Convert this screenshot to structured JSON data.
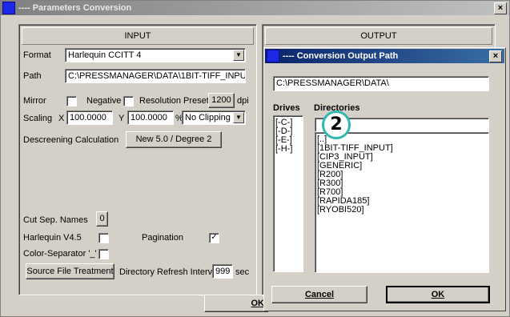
{
  "main_window": {
    "title": "----   Parameters Conversion",
    "close_glyph": "×"
  },
  "input_panel": {
    "header": "INPUT",
    "format_label": "Format",
    "format_value": "Harlequin CCITT 4",
    "path_label": "Path",
    "path_value": "C:\\PRESSMANAGER\\DATA\\1BIT-TIFF_INPU",
    "mirror_label": "Mirror",
    "negative_label": "Negative",
    "resolution_preset_label": "Resolution Preset",
    "resolution_value": "1200",
    "resolution_unit": "dpi",
    "scaling_label": "Scaling",
    "scaling_x_label": "X",
    "scaling_x_value": "100.0000",
    "scaling_y_label": "Y",
    "scaling_y_value": "100.0000",
    "percent_label": "%",
    "clipping_value": "No Clipping",
    "descreening_label": "Descreening Calculation",
    "descreening_button": "New 5.0 / Degree 2",
    "cut_sep_names_label": "Cut Sep. Names",
    "cut_sep_names_value": "0",
    "harlequin_label": "Harlequin V4.5",
    "pagination_label": "Pagination",
    "color_separator_label": "Color-Separator '_'",
    "source_file_button": "Source File Treatment",
    "directory_refresh_label": "Directory Refresh Interv.",
    "directory_refresh_value": "999",
    "directory_refresh_unit": "sec",
    "checkboxes": {
      "mirror": false,
      "negative": false,
      "harlequin": false,
      "pagination": true,
      "color_separator": false
    },
    "check_glyph": "✓"
  },
  "output_panel": {
    "header": "OUTPUT"
  },
  "main_ok_button": "OK",
  "dialog": {
    "title": "----  Conversion Output Path",
    "close_glyph": "×",
    "path_value": "C:\\PRESSMANAGER\\DATA\\",
    "drives_label": "Drives",
    "directories_label": "Directories",
    "drives": [
      "[-C-]",
      "[-D-]",
      "[-E-]",
      "[-H-]"
    ],
    "directories": [
      "[..]",
      "[1BIT-TIFF_INPUT]",
      "[CIP3_INPUT]",
      "[GENERIC]",
      "[R200]",
      "[R300]",
      "[R700]",
      "[RAPIDA185]",
      "[RYOBI520]"
    ],
    "cancel_button": "Cancel",
    "ok_button": "OK"
  },
  "callout_badge": "2",
  "colors": {
    "window_face": "#d4d0c8",
    "active_title": "#0a246a",
    "inactive_title": "#808080",
    "badge_ring": "#30b8b0"
  },
  "icons": {
    "window_icon": "blue-square-icon",
    "dropdown_arrow": "▼"
  }
}
